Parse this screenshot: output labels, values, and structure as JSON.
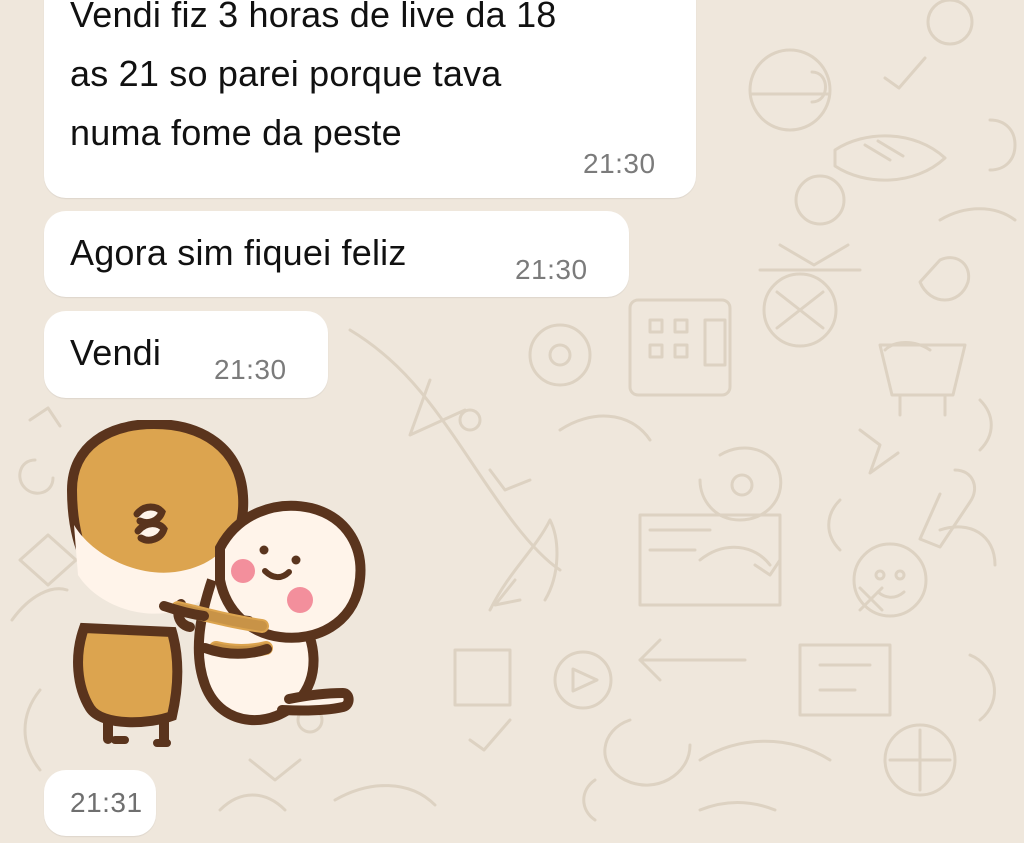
{
  "messages": [
    {
      "lines": [
        "Vendi fiz 3 horas de live da 18",
        "as 21 so parei porque tava",
        "numa fome da peste"
      ],
      "time": "21:30"
    },
    {
      "lines": [
        "Agora sim fiquei feliz"
      ],
      "time": "21:30"
    },
    {
      "lines": [
        "Vendi"
      ],
      "time": "21:30"
    }
  ],
  "sticker": {
    "time": "21:31",
    "description_icon": "hugging-sticker"
  },
  "colors": {
    "background": "#efe7dc",
    "bubble": "#ffffff",
    "text": "#111111",
    "time": "#7b7b7b",
    "pattern": "#ddd2c2"
  }
}
